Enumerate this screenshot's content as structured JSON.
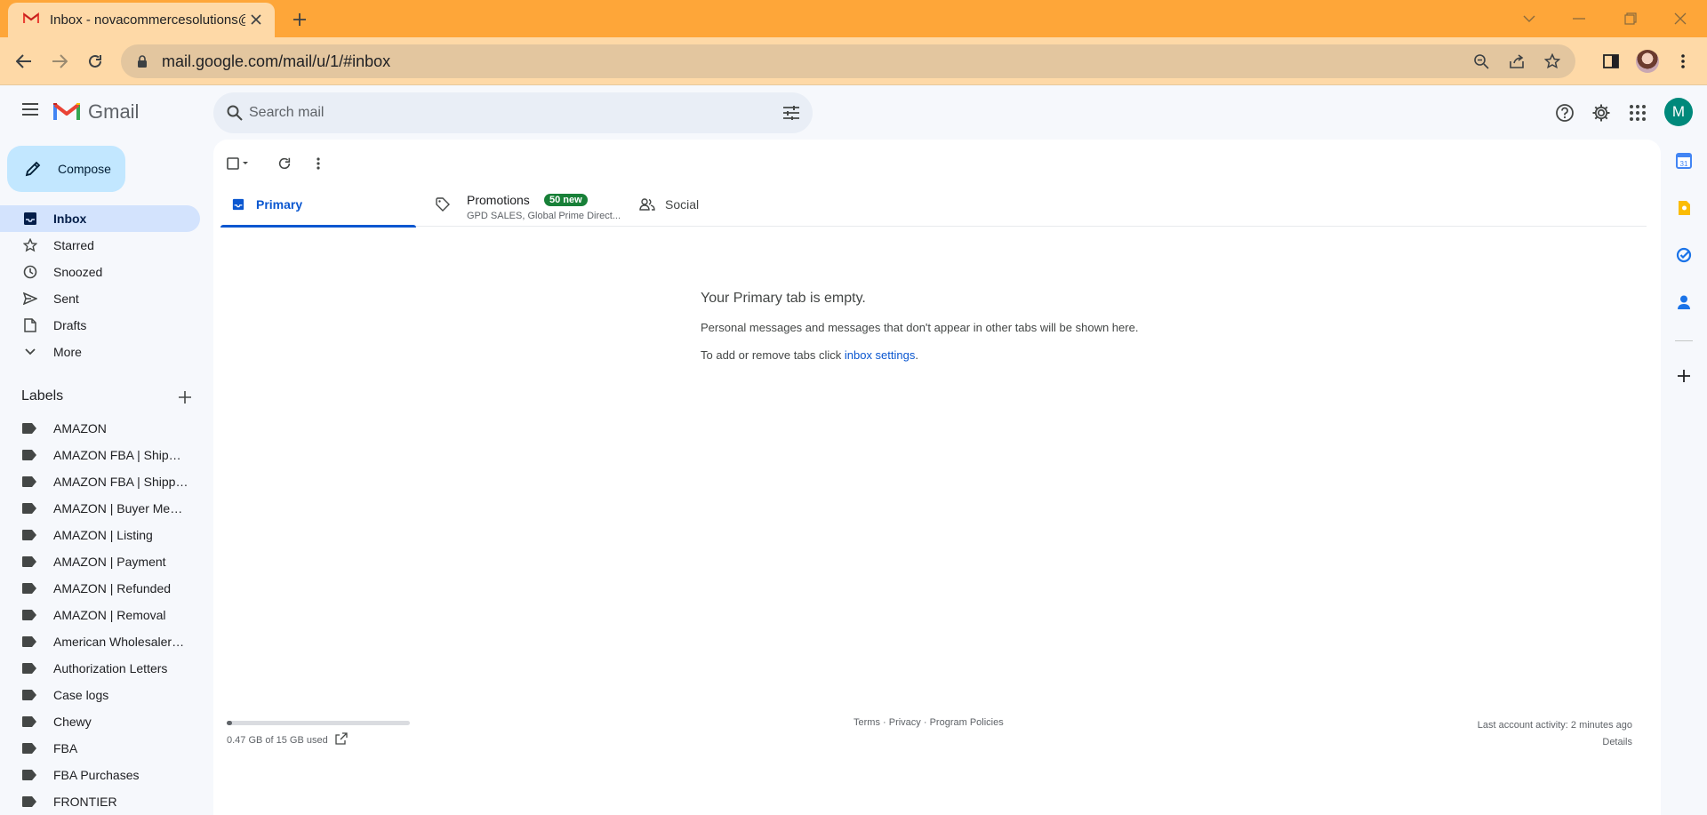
{
  "browser": {
    "tab_title": "Inbox - novacommercesolutions@",
    "url": "mail.google.com/mail/u/1/#inbox"
  },
  "gmail": {
    "brand": "Gmail",
    "search_placeholder": "Search mail",
    "account_initial": "M"
  },
  "compose": {
    "label": "Compose"
  },
  "nav": {
    "items": [
      {
        "label": "Inbox",
        "icon": "inbox-icon",
        "active": true
      },
      {
        "label": "Starred",
        "icon": "star-icon"
      },
      {
        "label": "Snoozed",
        "icon": "clock-icon"
      },
      {
        "label": "Sent",
        "icon": "send-icon"
      },
      {
        "label": "Drafts",
        "icon": "draft-icon"
      },
      {
        "label": "More",
        "icon": "chevron-down-icon"
      }
    ]
  },
  "labels": {
    "title": "Labels",
    "items": [
      "AMAZON",
      "AMAZON FBA | Shipmen...",
      "AMAZON FBA | Shipped...",
      "AMAZON | Buyer Messa...",
      "AMAZON | Listing",
      "AMAZON | Payment",
      "AMAZON | Refunded",
      "AMAZON | Removal",
      "American Wholesalers L...",
      "Authorization Letters",
      "Case logs",
      "Chewy",
      "FBA",
      "FBA Purchases",
      "FRONTIER"
    ]
  },
  "tabs": {
    "primary": "Primary",
    "promotions": "Promotions",
    "promotions_badge": "50 new",
    "promotions_senders": "GPD SALES, Global Prime Direct...",
    "social": "Social"
  },
  "empty_state": {
    "title": "Your Primary tab is empty.",
    "line1": "Personal messages and messages that don't appear in other tabs will be shown here.",
    "line2_prefix": "To add or remove tabs click ",
    "line2_link": "inbox settings",
    "line2_suffix": "."
  },
  "footer": {
    "storage_text": "0.47 GB of 15 GB used",
    "storage_used_fraction": 0.031,
    "terms": "Terms",
    "privacy": "Privacy",
    "policies": "Program Policies",
    "separator": " · ",
    "activity": "Last account activity: 2 minutes ago",
    "details": "Details"
  },
  "colors": {
    "chrome_tabstrip": "#fea639",
    "chrome_toolbar": "#fed9a7",
    "compose_bg": "#c2e7ff",
    "active_nav": "#d3e3fd",
    "accent": "#0b57d0",
    "badge_green": "#188038",
    "avatar": "#00897b"
  }
}
